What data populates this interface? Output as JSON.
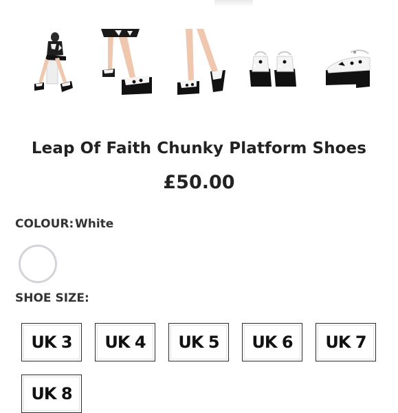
{
  "product": {
    "title": "Leap Of Faith Chunky Platform Shoes",
    "price": "£50.00"
  },
  "gallery": {
    "thumbnails": [
      {
        "icon": "model-seated-platform-shoes-photo"
      },
      {
        "icon": "model-legs-crossed-shoes-photo"
      },
      {
        "icon": "model-legs-standing-shoes-photo"
      },
      {
        "icon": "shoes-pair-back-view-photo"
      },
      {
        "icon": "shoe-side-view-photo"
      }
    ]
  },
  "colour": {
    "label": "COLOUR:",
    "value": "White",
    "swatch_color": "#ffffff",
    "swatch_border": "#d4d3dc"
  },
  "size": {
    "label": "SHOE SIZE:",
    "options": [
      "UK 3",
      "UK 4",
      "UK 5",
      "UK 6",
      "UK 7",
      "UK 8"
    ]
  }
}
